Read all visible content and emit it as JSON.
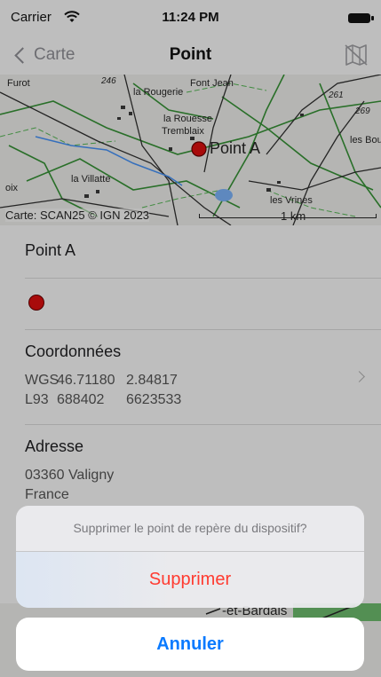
{
  "status_bar": {
    "carrier": "Carrier",
    "time": "11:24 PM"
  },
  "nav": {
    "back_label": "Carte",
    "title": "Point",
    "map_icon": "map-icon"
  },
  "map": {
    "point_label": "Point A",
    "credit": "Carte: SCAN25 © IGN 2023",
    "scale": "1 km",
    "labels": [
      "Furot",
      "246",
      "la Rougerie",
      "Font Jean",
      "261",
      "269",
      "la Rouesse",
      "Tremblaix",
      "les Boula",
      "la Villatte",
      "oix",
      "les Vrines"
    ]
  },
  "point": {
    "name": "Point A",
    "color": "#c00d0d"
  },
  "coordinates": {
    "title": "Coordonnées",
    "rows": [
      {
        "system": "WGS",
        "a": "46.71180",
        "b": "2.84817"
      },
      {
        "system": "L93",
        "a": "688402",
        "b": "6623533"
      }
    ]
  },
  "address": {
    "title": "Adresse",
    "line1": "03360 Valigny",
    "line2": "France"
  },
  "peek_map": {
    "label": "-et-Bardais"
  },
  "action_sheet": {
    "message": "Supprimer le point de repère du dispositif?",
    "destructive_label": "Supprimer",
    "cancel_label": "Annuler"
  },
  "colors": {
    "destructive": "#ff3b30",
    "accent": "#0a7aff"
  }
}
